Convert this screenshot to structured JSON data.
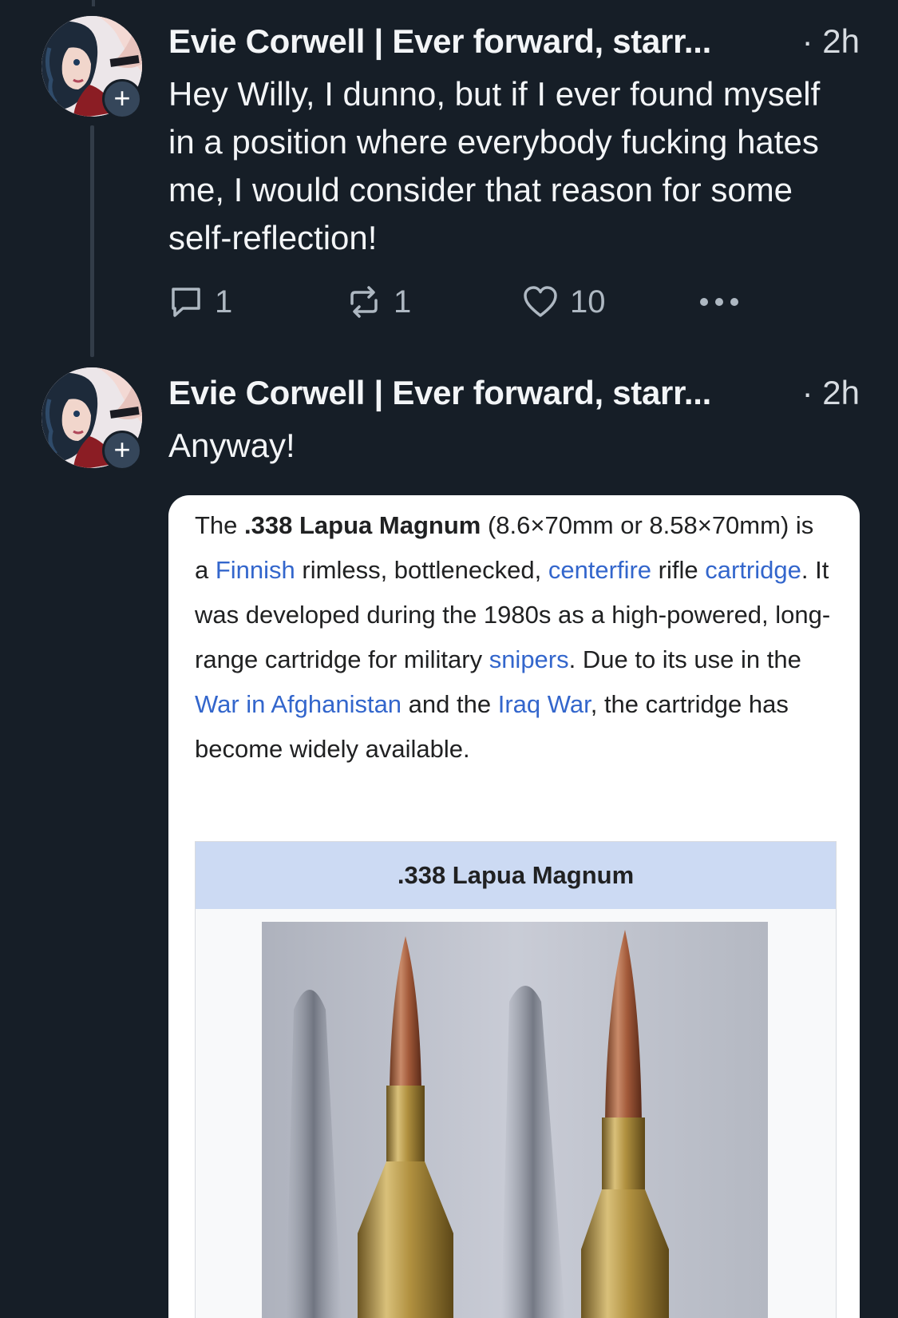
{
  "posts": [
    {
      "author": "Evie Corwell | Ever forward, starr...",
      "time": "· 2h",
      "text": "Hey Willy, I dunno, but if I ever found myself in a position where everybody fucking hates me, I would consider that reason for some self-reflection!",
      "follow_badge": "+",
      "actions": {
        "replies": "1",
        "reposts": "1",
        "likes": "10",
        "more": "•••"
      }
    },
    {
      "author": "Evie Corwell | Ever forward, starr...",
      "time": "· 2h",
      "text": "Anyway!",
      "follow_badge": "+"
    }
  ],
  "embed": {
    "paragraph": {
      "t1": "The ",
      "title_bold": ".338 Lapua Magnum",
      "t2": " (8.6×70mm or 8.58×70mm) is a ",
      "link_finnish": "Finnish",
      "t3": " rimless, bottlenecked, ",
      "link_centerfire": "centerfire",
      "t4": " rifle ",
      "link_cartridge": "cartridge",
      "t5": ". It was developed during the 1980s as a high-powered, long-range cartridge for military ",
      "link_snipers": "snipers",
      "t6": ". Due to its use in the ",
      "link_afghanistan": "War in Afghanistan",
      "t7": " and the ",
      "link_iraq": "Iraq War",
      "t8": ", the cartridge has become widely available."
    },
    "infobox_title": ".338 Lapua Magnum"
  },
  "colors": {
    "background": "#161e27",
    "text": "#f3f5f7",
    "muted": "#aeb8c2",
    "wiki_link": "#3366cc",
    "infobox_header": "#ccdaf3"
  },
  "icons": {
    "reply": "speech-bubble-icon",
    "repost": "repost-arrows-icon",
    "like": "heart-icon",
    "more": "ellipsis-icon"
  }
}
